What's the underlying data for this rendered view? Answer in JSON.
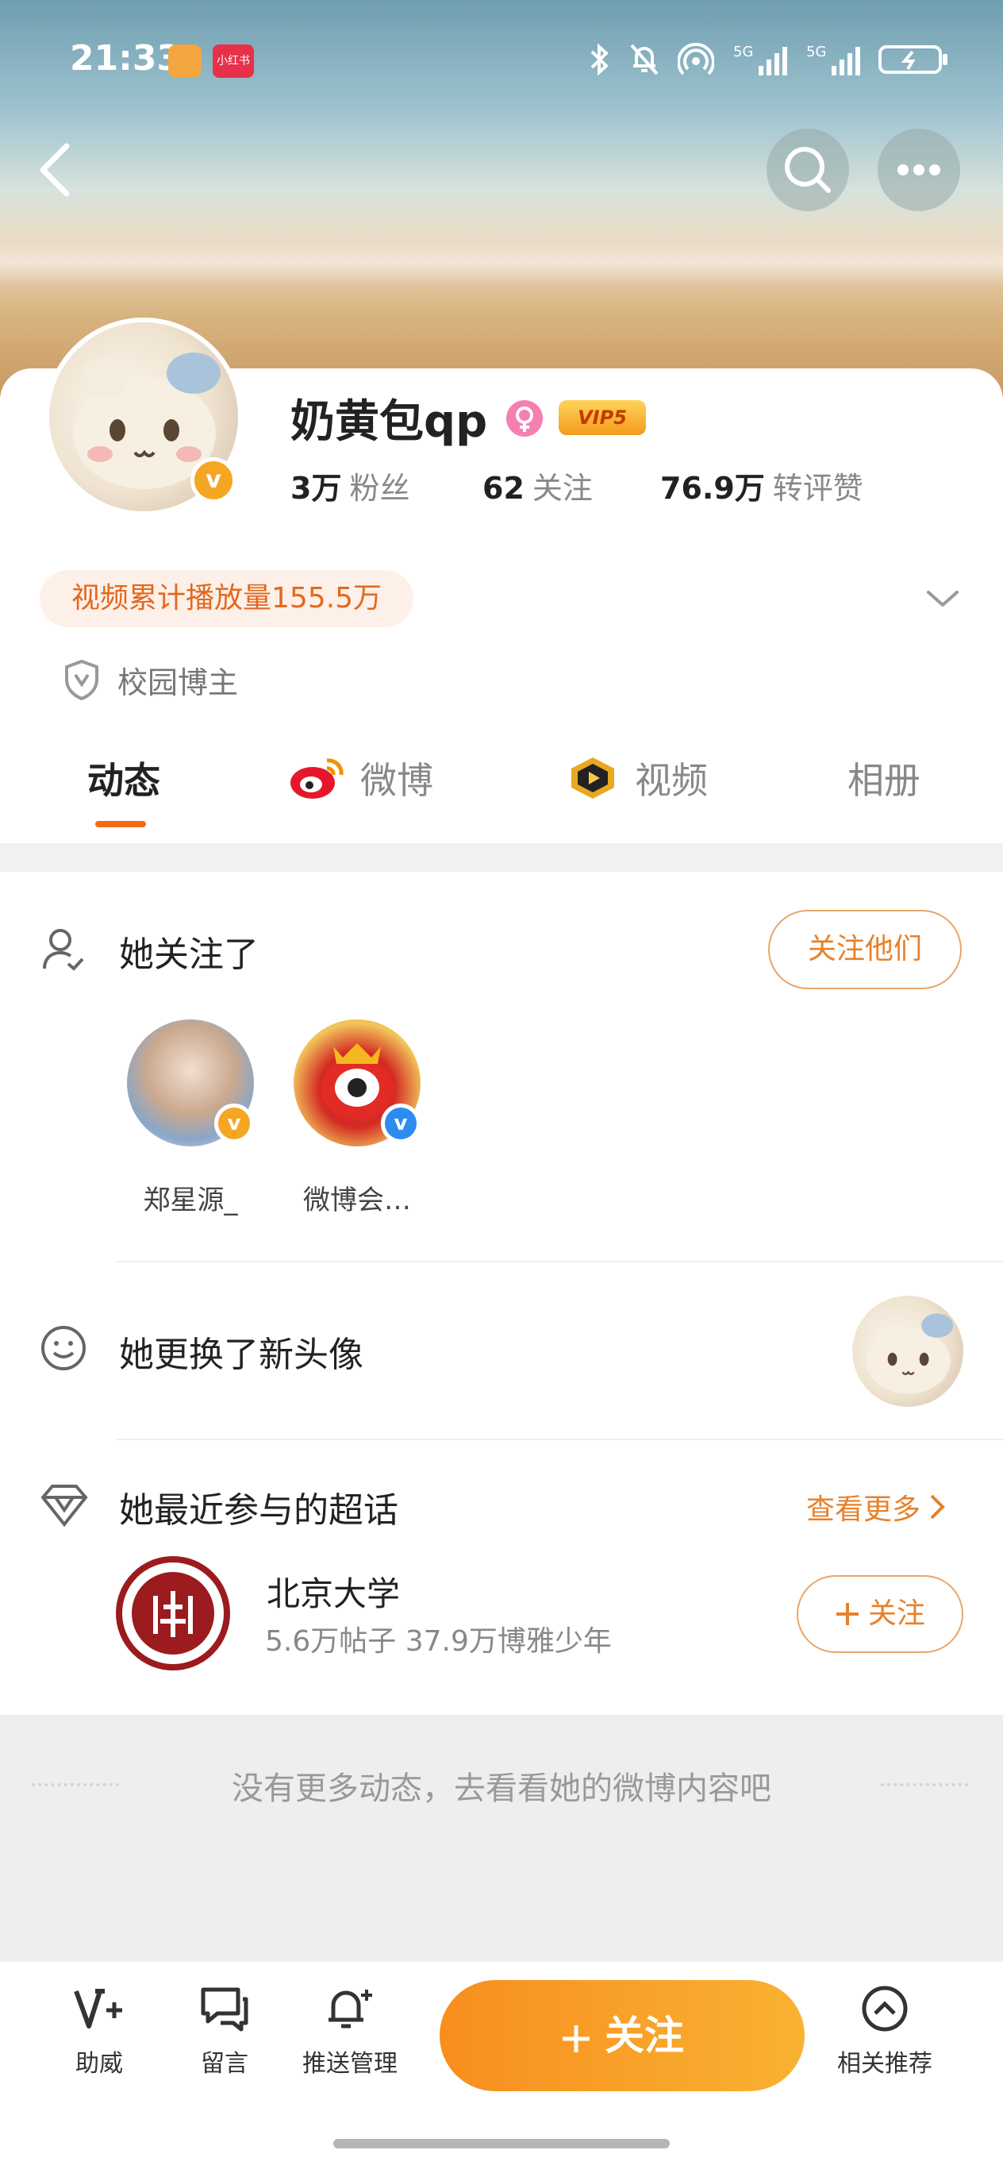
{
  "status_bar": {
    "time": "21:33",
    "app_badge": "小红书"
  },
  "profile": {
    "name": "奶黄包qp",
    "vip_label": "VIP5",
    "stats": [
      {
        "value": "3万",
        "label": "粉丝"
      },
      {
        "value": "62",
        "label": "关注"
      },
      {
        "value": "76.9万",
        "label": "转评赞"
      }
    ],
    "video_plays": "视频累计播放量155.5万",
    "tag": "校园博主"
  },
  "tabs": [
    {
      "label": "动态",
      "active": true
    },
    {
      "label": "微博",
      "active": false
    },
    {
      "label": "视频",
      "active": false
    },
    {
      "label": "相册",
      "active": false
    }
  ],
  "following_section": {
    "title": "她关注了",
    "button": "关注他们",
    "users": [
      {
        "name": "郑星源_"
      },
      {
        "name": "微博会…"
      }
    ]
  },
  "avatar_change": {
    "title": "她更换了新头像"
  },
  "super_topics": {
    "title": "她最近参与的超话",
    "see_more": "查看更多",
    "items": [
      {
        "name": "北京大学",
        "meta": "5.6万帖子 37.9万博雅少年",
        "button": "关注"
      }
    ]
  },
  "footer_note": "没有更多动态，去看看她的微博内容吧",
  "bottom_bar": {
    "items": [
      {
        "label": "助威"
      },
      {
        "label": "留言"
      },
      {
        "label": "推送管理"
      },
      {
        "label": "相关推荐"
      }
    ],
    "follow_button": "关注"
  },
  "colors": {
    "accent": "#f46a11",
    "button_gradient_start": "#f78e1e",
    "button_gradient_end": "#f9b232"
  }
}
